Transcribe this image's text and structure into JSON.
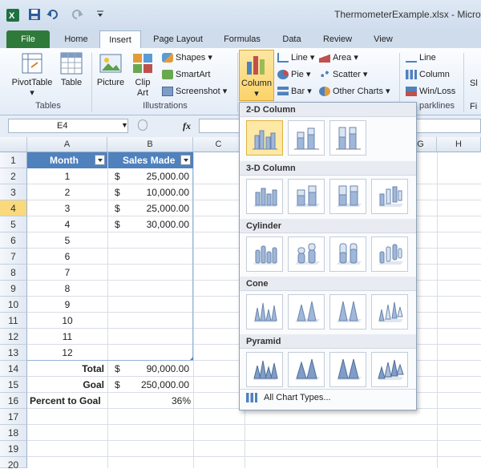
{
  "window": {
    "title": "ThermometerExample.xlsx - Micros"
  },
  "tabs": [
    {
      "label": "File"
    },
    {
      "label": "Home"
    },
    {
      "label": "Insert"
    },
    {
      "label": "Page Layout"
    },
    {
      "label": "Formulas"
    },
    {
      "label": "Data"
    },
    {
      "label": "Review"
    },
    {
      "label": "View"
    }
  ],
  "ribbon": {
    "tables": {
      "pivottable": "PivotTable",
      "table": "Table",
      "group": "Tables"
    },
    "illustrations": {
      "picture": "Picture",
      "clip_art_1": "Clip",
      "clip_art_2": "Art",
      "shapes": "Shapes",
      "smartart": "SmartArt",
      "screenshot": "Screenshot",
      "group": "Illustrations"
    },
    "charts": {
      "column": "Column",
      "line": "Line",
      "pie": "Pie",
      "bar": "Bar",
      "area": "Area",
      "scatter": "Scatter",
      "other": "Other Charts"
    },
    "sparklines": {
      "line": "Line",
      "column": "Column",
      "winloss": "Win/Loss",
      "group": "parklines"
    },
    "cut_1": "Sl",
    "cut_2": "Fi"
  },
  "formula_bar": {
    "cell_ref": "E4",
    "fx": "fx"
  },
  "columns": [
    "A",
    "B",
    "C",
    "G",
    "H"
  ],
  "rows": [
    "1",
    "2",
    "3",
    "4",
    "5",
    "6",
    "7",
    "8",
    "9",
    "10",
    "11",
    "12",
    "13",
    "14",
    "15",
    "16",
    "17",
    "18",
    "19",
    "20"
  ],
  "table": {
    "headers": [
      "Month",
      "Sales Made"
    ],
    "months": [
      "1",
      "2",
      "3",
      "4",
      "5",
      "6",
      "7",
      "8",
      "9",
      "10",
      "11",
      "12"
    ],
    "sales": [
      {
        "dollar": "$",
        "amount": "25,000.00"
      },
      {
        "dollar": "$",
        "amount": "10,000.00"
      },
      {
        "dollar": "$",
        "amount": "25,000.00"
      },
      {
        "dollar": "$",
        "amount": "30,000.00"
      }
    ],
    "total_label": "Total",
    "total_dollar": "$",
    "total_value": "90,000.00",
    "goal_label": "Goal",
    "goal_dollar": "$",
    "goal_value": "250,000.00",
    "pct_label": "Percent to Goal",
    "pct_value": "36%"
  },
  "chart_menu": {
    "sections": [
      "2-D Column",
      "3-D Column",
      "Cylinder",
      "Cone",
      "Pyramid"
    ],
    "all_types": "All Chart Types..."
  },
  "colors": {
    "table_header": "#4f81bd",
    "file_tab": "#2f7a3a",
    "selection": "#f9d97b"
  }
}
